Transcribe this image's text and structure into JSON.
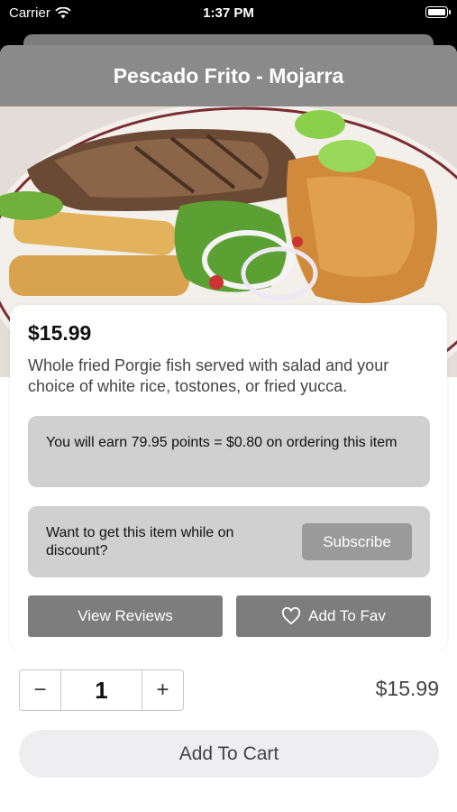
{
  "status_bar": {
    "carrier": "Carrier",
    "time": "1:37 PM"
  },
  "nav": {
    "title": "Pescado Frito - Mojarra"
  },
  "item": {
    "price": "$15.99",
    "description": "Whole fried Porgie fish served with salad and your choice of white rice, tostones, or fried yucca.",
    "points_text": "You will earn 79.95 points = $0.80 on ordering this item",
    "discount_text": "Want to get this item while on discount?",
    "subscribe_label": "Subscribe",
    "view_reviews_label": "View Reviews",
    "add_fav_label": "Add To Fav"
  },
  "cart": {
    "minus": "−",
    "quantity": "1",
    "plus": "+",
    "total": "$15.99",
    "add_to_cart_label": "Add To Cart"
  },
  "icons": {
    "wifi": "wifi-icon",
    "battery": "battery-icon",
    "heart": "heart-icon"
  }
}
